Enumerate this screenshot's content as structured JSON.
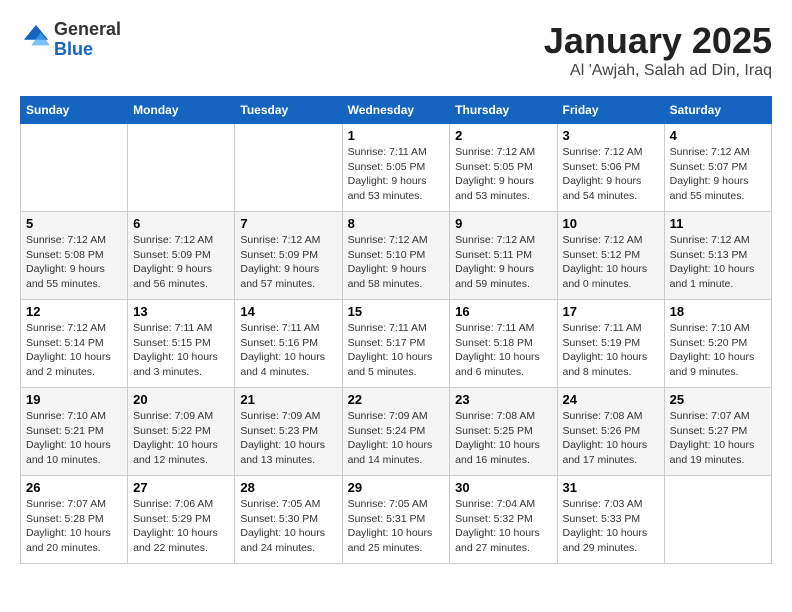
{
  "header": {
    "logo_line1": "General",
    "logo_line2": "Blue",
    "title": "January 2025",
    "subtitle": "Al 'Awjah, Salah ad Din, Iraq"
  },
  "days_of_week": [
    "Sunday",
    "Monday",
    "Tuesday",
    "Wednesday",
    "Thursday",
    "Friday",
    "Saturday"
  ],
  "weeks": [
    [
      {
        "day": "",
        "sunrise": "",
        "sunset": "",
        "daylight": ""
      },
      {
        "day": "",
        "sunrise": "",
        "sunset": "",
        "daylight": ""
      },
      {
        "day": "",
        "sunrise": "",
        "sunset": "",
        "daylight": ""
      },
      {
        "day": "1",
        "sunrise": "Sunrise: 7:11 AM",
        "sunset": "Sunset: 5:05 PM",
        "daylight": "Daylight: 9 hours and 53 minutes."
      },
      {
        "day": "2",
        "sunrise": "Sunrise: 7:12 AM",
        "sunset": "Sunset: 5:05 PM",
        "daylight": "Daylight: 9 hours and 53 minutes."
      },
      {
        "day": "3",
        "sunrise": "Sunrise: 7:12 AM",
        "sunset": "Sunset: 5:06 PM",
        "daylight": "Daylight: 9 hours and 54 minutes."
      },
      {
        "day": "4",
        "sunrise": "Sunrise: 7:12 AM",
        "sunset": "Sunset: 5:07 PM",
        "daylight": "Daylight: 9 hours and 55 minutes."
      }
    ],
    [
      {
        "day": "5",
        "sunrise": "Sunrise: 7:12 AM",
        "sunset": "Sunset: 5:08 PM",
        "daylight": "Daylight: 9 hours and 55 minutes."
      },
      {
        "day": "6",
        "sunrise": "Sunrise: 7:12 AM",
        "sunset": "Sunset: 5:09 PM",
        "daylight": "Daylight: 9 hours and 56 minutes."
      },
      {
        "day": "7",
        "sunrise": "Sunrise: 7:12 AM",
        "sunset": "Sunset: 5:09 PM",
        "daylight": "Daylight: 9 hours and 57 minutes."
      },
      {
        "day": "8",
        "sunrise": "Sunrise: 7:12 AM",
        "sunset": "Sunset: 5:10 PM",
        "daylight": "Daylight: 9 hours and 58 minutes."
      },
      {
        "day": "9",
        "sunrise": "Sunrise: 7:12 AM",
        "sunset": "Sunset: 5:11 PM",
        "daylight": "Daylight: 9 hours and 59 minutes."
      },
      {
        "day": "10",
        "sunrise": "Sunrise: 7:12 AM",
        "sunset": "Sunset: 5:12 PM",
        "daylight": "Daylight: 10 hours and 0 minutes."
      },
      {
        "day": "11",
        "sunrise": "Sunrise: 7:12 AM",
        "sunset": "Sunset: 5:13 PM",
        "daylight": "Daylight: 10 hours and 1 minute."
      }
    ],
    [
      {
        "day": "12",
        "sunrise": "Sunrise: 7:12 AM",
        "sunset": "Sunset: 5:14 PM",
        "daylight": "Daylight: 10 hours and 2 minutes."
      },
      {
        "day": "13",
        "sunrise": "Sunrise: 7:11 AM",
        "sunset": "Sunset: 5:15 PM",
        "daylight": "Daylight: 10 hours and 3 minutes."
      },
      {
        "day": "14",
        "sunrise": "Sunrise: 7:11 AM",
        "sunset": "Sunset: 5:16 PM",
        "daylight": "Daylight: 10 hours and 4 minutes."
      },
      {
        "day": "15",
        "sunrise": "Sunrise: 7:11 AM",
        "sunset": "Sunset: 5:17 PM",
        "daylight": "Daylight: 10 hours and 5 minutes."
      },
      {
        "day": "16",
        "sunrise": "Sunrise: 7:11 AM",
        "sunset": "Sunset: 5:18 PM",
        "daylight": "Daylight: 10 hours and 6 minutes."
      },
      {
        "day": "17",
        "sunrise": "Sunrise: 7:11 AM",
        "sunset": "Sunset: 5:19 PM",
        "daylight": "Daylight: 10 hours and 8 minutes."
      },
      {
        "day": "18",
        "sunrise": "Sunrise: 7:10 AM",
        "sunset": "Sunset: 5:20 PM",
        "daylight": "Daylight: 10 hours and 9 minutes."
      }
    ],
    [
      {
        "day": "19",
        "sunrise": "Sunrise: 7:10 AM",
        "sunset": "Sunset: 5:21 PM",
        "daylight": "Daylight: 10 hours and 10 minutes."
      },
      {
        "day": "20",
        "sunrise": "Sunrise: 7:09 AM",
        "sunset": "Sunset: 5:22 PM",
        "daylight": "Daylight: 10 hours and 12 minutes."
      },
      {
        "day": "21",
        "sunrise": "Sunrise: 7:09 AM",
        "sunset": "Sunset: 5:23 PM",
        "daylight": "Daylight: 10 hours and 13 minutes."
      },
      {
        "day": "22",
        "sunrise": "Sunrise: 7:09 AM",
        "sunset": "Sunset: 5:24 PM",
        "daylight": "Daylight: 10 hours and 14 minutes."
      },
      {
        "day": "23",
        "sunrise": "Sunrise: 7:08 AM",
        "sunset": "Sunset: 5:25 PM",
        "daylight": "Daylight: 10 hours and 16 minutes."
      },
      {
        "day": "24",
        "sunrise": "Sunrise: 7:08 AM",
        "sunset": "Sunset: 5:26 PM",
        "daylight": "Daylight: 10 hours and 17 minutes."
      },
      {
        "day": "25",
        "sunrise": "Sunrise: 7:07 AM",
        "sunset": "Sunset: 5:27 PM",
        "daylight": "Daylight: 10 hours and 19 minutes."
      }
    ],
    [
      {
        "day": "26",
        "sunrise": "Sunrise: 7:07 AM",
        "sunset": "Sunset: 5:28 PM",
        "daylight": "Daylight: 10 hours and 20 minutes."
      },
      {
        "day": "27",
        "sunrise": "Sunrise: 7:06 AM",
        "sunset": "Sunset: 5:29 PM",
        "daylight": "Daylight: 10 hours and 22 minutes."
      },
      {
        "day": "28",
        "sunrise": "Sunrise: 7:05 AM",
        "sunset": "Sunset: 5:30 PM",
        "daylight": "Daylight: 10 hours and 24 minutes."
      },
      {
        "day": "29",
        "sunrise": "Sunrise: 7:05 AM",
        "sunset": "Sunset: 5:31 PM",
        "daylight": "Daylight: 10 hours and 25 minutes."
      },
      {
        "day": "30",
        "sunrise": "Sunrise: 7:04 AM",
        "sunset": "Sunset: 5:32 PM",
        "daylight": "Daylight: 10 hours and 27 minutes."
      },
      {
        "day": "31",
        "sunrise": "Sunrise: 7:03 AM",
        "sunset": "Sunset: 5:33 PM",
        "daylight": "Daylight: 10 hours and 29 minutes."
      },
      {
        "day": "",
        "sunrise": "",
        "sunset": "",
        "daylight": ""
      }
    ]
  ]
}
